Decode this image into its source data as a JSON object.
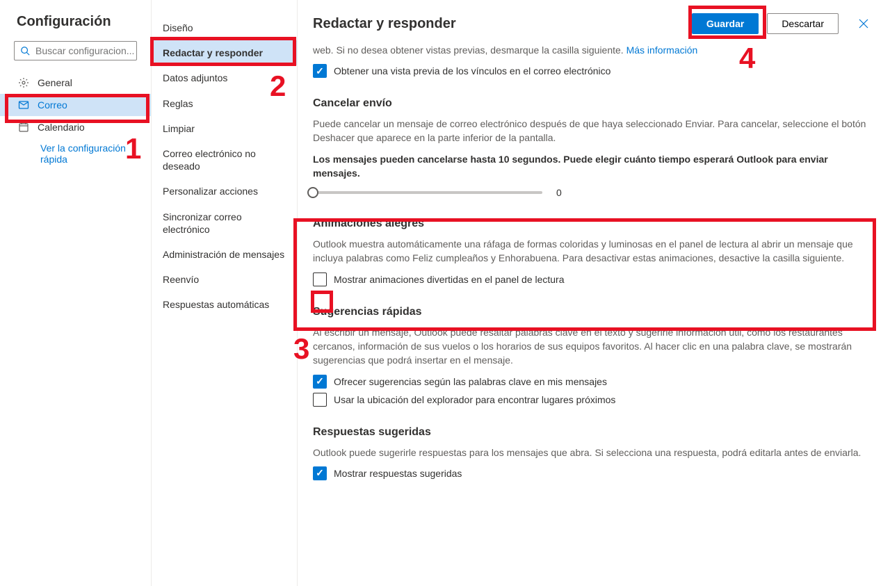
{
  "sidebar": {
    "title": "Configuración",
    "search_placeholder": "Buscar configuracion...",
    "items": [
      {
        "label": "General"
      },
      {
        "label": "Correo"
      },
      {
        "label": "Calendario"
      }
    ],
    "quick_link": "Ver la configuración rápida"
  },
  "midnav": {
    "items": [
      "Diseño",
      "Redactar y responder",
      "Datos adjuntos",
      "Reglas",
      "Limpiar",
      "Correo electrónico no deseado",
      "Personalizar acciones",
      "Sincronizar correo electrónico",
      "Administración de mensajes",
      "Reenvío",
      "Respuestas automáticas"
    ]
  },
  "header": {
    "title": "Redactar y responder",
    "save": "Guardar",
    "discard": "Descartar"
  },
  "content": {
    "intro_text": "web. Si no desea obtener vistas previas, desmarque la casilla siguiente. ",
    "intro_link": "Más información",
    "preview_checkbox": "Obtener una vista previa de los vínculos en el correo electrónico",
    "cancel_send": {
      "title": "Cancelar envío",
      "desc": "Puede cancelar un mensaje de correo electrónico después de que haya seleccionado Enviar. Para cancelar, seleccione el botón Deshacer que aparece en la parte inferior de la pantalla.",
      "bold": "Los mensajes pueden cancelarse hasta 10 segundos. Puede elegir cuánto tiempo esperará Outlook para enviar mensajes.",
      "value": "0"
    },
    "joyful": {
      "title": "Animaciones alegres",
      "desc": "Outlook muestra automáticamente una ráfaga de formas coloridas y luminosas en el panel de lectura al abrir un mensaje que incluya palabras como Feliz cumpleaños y Enhorabuena. Para desactivar estas animaciones, desactive la casilla siguiente.",
      "checkbox": "Mostrar animaciones divertidas en el panel de lectura"
    },
    "quick_sug": {
      "title": "Sugerencias rápidas",
      "desc": "Al escribir un mensaje, Outlook puede resaltar palabras clave en el texto y sugerirle información útil, como los restaurantes cercanos, información de sus vuelos o los horarios de sus equipos favoritos. Al hacer clic en una palabra clave, se mostrarán sugerencias que podrá insertar en el mensaje.",
      "chk1": "Ofrecer sugerencias según las palabras clave en mis mensajes",
      "chk2": "Usar la ubicación del explorador para encontrar lugares próximos"
    },
    "sug_replies": {
      "title": "Respuestas sugeridas",
      "desc": "Outlook puede sugerirle respuestas para los mensajes que abra. Si selecciona una respuesta, podrá editarla antes de enviarla.",
      "checkbox": "Mostrar respuestas sugeridas"
    }
  },
  "annotations": {
    "n1": "1",
    "n2": "2",
    "n3": "3",
    "n4": "4"
  }
}
